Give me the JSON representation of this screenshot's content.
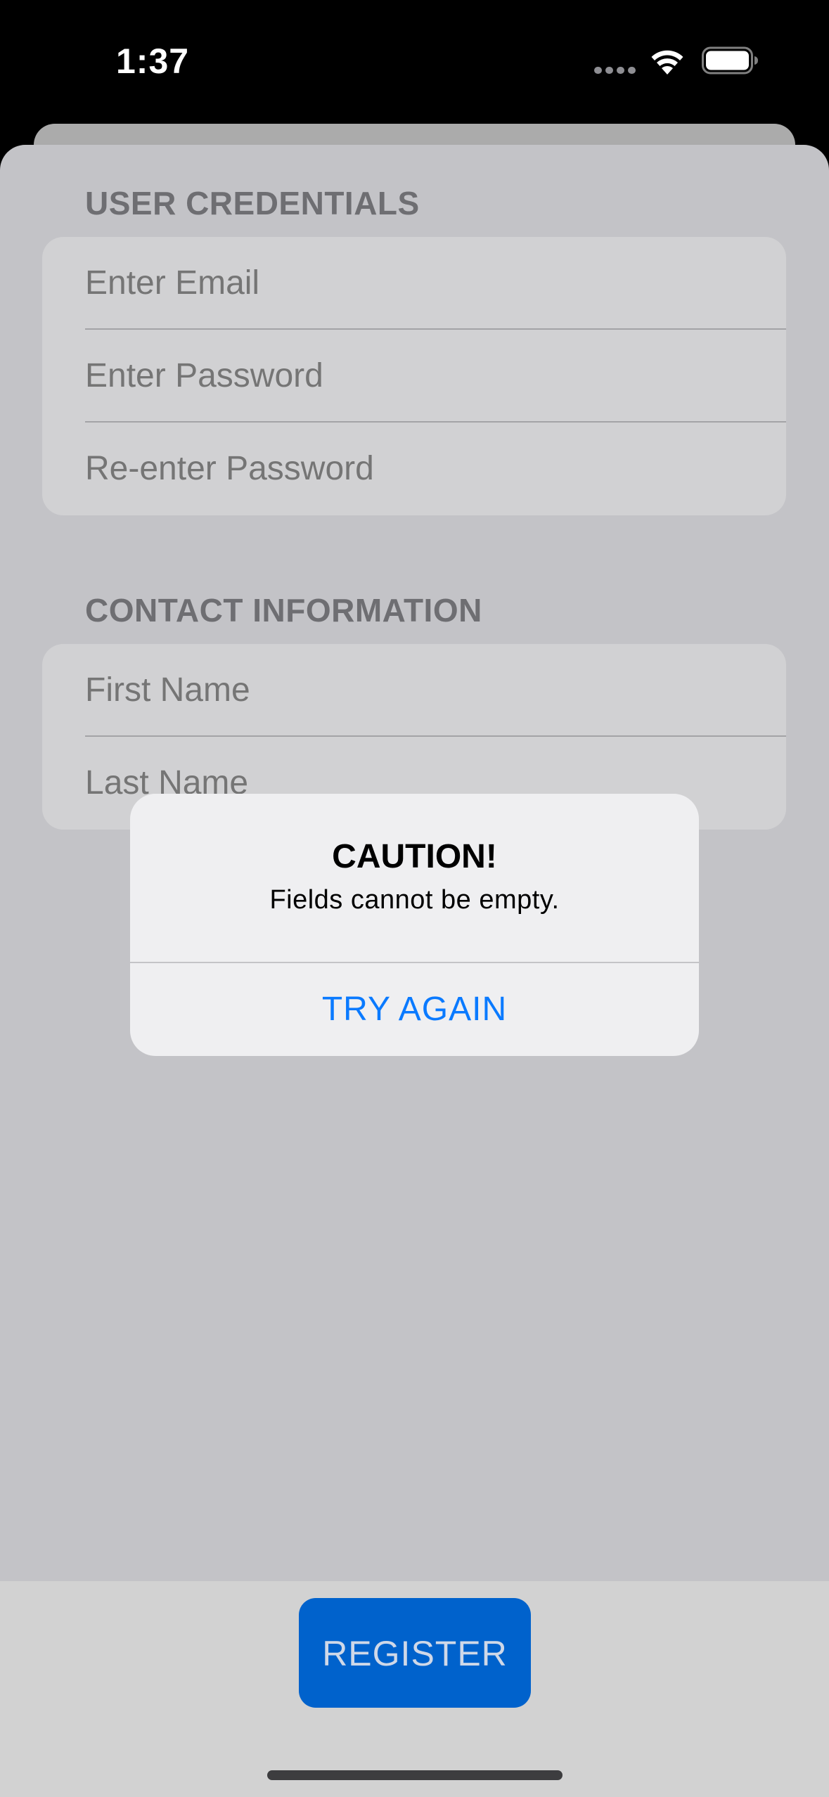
{
  "status_bar": {
    "time": "1:37"
  },
  "icons": {
    "wifi": "wifi-icon",
    "battery": "battery-icon",
    "signal": "signal-dots-icon"
  },
  "credentials_section": {
    "header": "USER CREDENTIALS",
    "fields": [
      {
        "placeholder": "Enter Email",
        "value": ""
      },
      {
        "placeholder": "Enter Password",
        "value": ""
      },
      {
        "placeholder": "Re-enter Password",
        "value": ""
      }
    ]
  },
  "contact_section": {
    "header": "CONTACT INFORMATION",
    "fields": [
      {
        "placeholder": "First Name",
        "value": ""
      },
      {
        "placeholder": "Last Name",
        "value": ""
      }
    ]
  },
  "alert": {
    "title": "CAUTION!",
    "message": "Fields cannot be empty.",
    "button_label": "TRY AGAIN"
  },
  "register_button": {
    "label": "REGISTER"
  },
  "colors": {
    "accent": "#0a7aff",
    "register_button": "#0062cc",
    "sheet_background": "#c3c3c7",
    "field_group_background": "#d1d1d3"
  }
}
